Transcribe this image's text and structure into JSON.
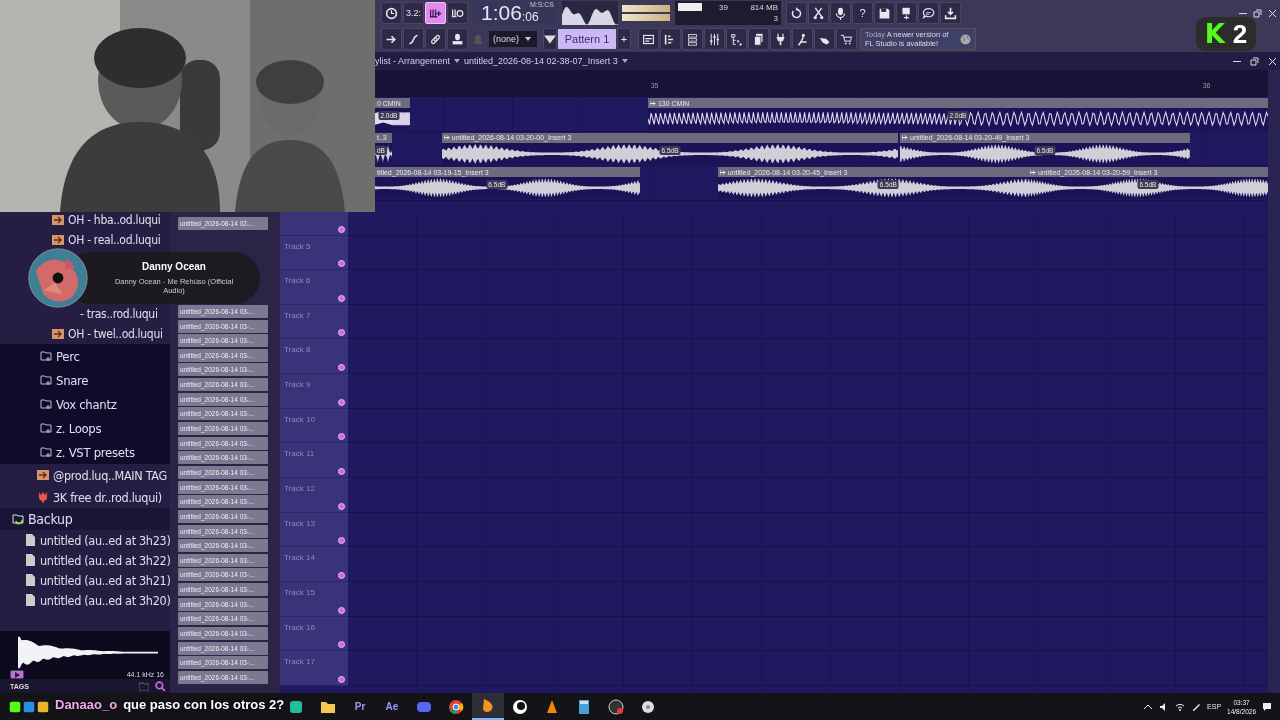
{
  "stream_badge": {
    "logo": "K",
    "count": "2"
  },
  "toolbar": {
    "modes": [
      {
        "kind": "wait",
        "selected": false
      },
      {
        "kind": "countdown",
        "label": "3.2:",
        "selected": false
      },
      {
        "kind": "step",
        "selected": true
      },
      {
        "kind": "loop",
        "selected": false
      }
    ],
    "time_main": "1:06",
    "time_small": ":06",
    "time_unit": "M:S:CS",
    "cpu": "39",
    "memory": "814 MB",
    "polyphony": "3",
    "actions": [
      {
        "kind": "undo"
      },
      {
        "kind": "cut"
      },
      {
        "kind": "mic"
      },
      {
        "kind": "help",
        "label": "?"
      },
      {
        "kind": "save"
      },
      {
        "kind": "save-new"
      },
      {
        "kind": "chat"
      },
      {
        "kind": "download"
      }
    ],
    "tools": [
      {
        "kind": "arrow"
      },
      {
        "kind": "curve"
      },
      {
        "kind": "link"
      },
      {
        "kind": "stamp"
      }
    ],
    "pattern_selector": {
      "value": "(none)"
    },
    "pattern": "Pattern 1",
    "add_pattern": "+",
    "windows": [
      {
        "kind": "playlist"
      },
      {
        "kind": "piano"
      },
      {
        "kind": "channels"
      },
      {
        "kind": "mixer"
      },
      {
        "kind": "browser"
      },
      {
        "kind": "copy"
      },
      {
        "kind": "plug"
      },
      {
        "kind": "figure"
      },
      {
        "kind": "hand"
      },
      {
        "kind": "cart"
      }
    ],
    "news": {
      "date": "Today",
      "text": "A newer version of FL Studio is available!"
    }
  },
  "playlist": {
    "title": "ylist - Arrangement",
    "pattern": "untitled_2026-08-14 02-38-07_Insert 3",
    "ruler": [
      "35",
      "36"
    ],
    "lanes": [
      {
        "clips": [
          {
            "kind": "automation",
            "title": "0 CMIN",
            "gain": "2.0dB",
            "cut_off": true
          },
          {
            "kind": "automation",
            "title": "130 CMIN",
            "gain": "2.0dB",
            "cut_off": false
          }
        ]
      },
      {
        "clips": [
          {
            "kind": "audio",
            "title": "t..3",
            "gain": "dB",
            "cut_off": true
          },
          {
            "kind": "audio",
            "title": "untitled_2026-08-14 03-20-00_Insert 3",
            "gain": "6.5dB",
            "cut_off": false
          },
          {
            "kind": "audio",
            "title": "untitled_2026-08-14 03-20-49_Insert 3",
            "gain": "6.5dB",
            "cut_off": false
          }
        ]
      },
      {
        "clips": [
          {
            "kind": "audio",
            "title": "titled_2026-08-14 03-19-15_Insert 3",
            "gain": "6.5dB",
            "cut_off": true
          },
          {
            "kind": "audio",
            "title": "untitled_2026-08-14 03-20-45_Insert 3",
            "gain": "6.5dB",
            "cut_off": false
          },
          {
            "kind": "audio",
            "title": "untitled_2026-08-14 03-20-59_Insert 3",
            "gain": "6.5dB",
            "cut_off": false
          }
        ]
      }
    ],
    "tracks": [
      {
        "name": "Track 5"
      },
      {
        "name": "Track 6"
      },
      {
        "name": "Track 7"
      },
      {
        "name": "Track 8"
      },
      {
        "name": "Track 9"
      },
      {
        "name": "Track 10"
      },
      {
        "name": "Track 11"
      },
      {
        "name": "Track 12"
      },
      {
        "name": "Track 13"
      },
      {
        "name": "Track 14"
      },
      {
        "name": "Track 15"
      },
      {
        "name": "Track 16"
      },
      {
        "name": "Track 17"
      }
    ]
  },
  "channel_clips": [
    "untitled_2026-08-14 02-...",
    "untitled_2026-08-14 03-...",
    "untitled_2026-08-14 03-...",
    "untitled_2026-08-14 03-...",
    "untitled_2026-08-14 03-...",
    "untitled_2026-08-14 03-...",
    "untitled_2026-08-14 03-...",
    "untitled_2026-08-14 03-...",
    "untitled_2026-08-14 03-...",
    "untitled_2026-08-14 03-...",
    "untitled_2026-08-14 03-...",
    "untitled_2026-08-14 03-...",
    "untitled_2026-08-14 03-...",
    "untitled_2026-08-14 03-...",
    "untitled_2026-08-14 03-...",
    "untitled_2026-08-14 03-...",
    "untitled_2026-08-14 03-...",
    "untitled_2026-08-14 03-...",
    "untitled_2026-08-14 03-...",
    "untitled_2026-08-14 03-...",
    "untitled_2026-08-14 03-...",
    "untitled_2026-08-14 03-...",
    "untitled_2026-08-14 03-...",
    "untitled_2026-08-14 03-...",
    "untitled_2026-08-14 03-...",
    "untitled_2026-08-14 03-...",
    "untitled_2026-08-14 03-..."
  ],
  "browser": {
    "items": [
      {
        "kind": "audio",
        "label": "OH - hba..od.luqui"
      },
      {
        "kind": "audio",
        "label": "OH - real..od.luqui"
      },
      {
        "kind": "hidden"
      },
      {
        "kind": "hidden"
      },
      {
        "kind": "partial",
        "label": "- tras..rod.luqui"
      },
      {
        "kind": "audio",
        "label": "OH - twel..od.luqui"
      },
      {
        "kind": "folder",
        "label": "Perc"
      },
      {
        "kind": "folder",
        "label": "Snare"
      },
      {
        "kind": "folder",
        "label": "Vox chantz"
      },
      {
        "kind": "folder",
        "label": "z. Loops"
      },
      {
        "kind": "folder",
        "label": "z. VST presets"
      },
      {
        "kind": "tag",
        "label": "@prod.luq..MAIN TAG"
      },
      {
        "kind": "plugin",
        "label": "3K free dr..rod.luqui)"
      },
      {
        "kind": "backup",
        "label": "Backup",
        "expanded": true,
        "children": [
          {
            "kind": "file",
            "label": "untitled (au..ed at 3h23)"
          },
          {
            "kind": "file",
            "label": "untitled (au..ed at 3h22)"
          },
          {
            "kind": "file",
            "label": "untitled (au..ed at 3h21)"
          },
          {
            "kind": "file",
            "label": "untitled (au..ed at 3h20)"
          }
        ]
      }
    ],
    "sample_info": "44.1 kHz 16",
    "tags": "TAGS"
  },
  "now_playing": {
    "artist": "Danny Ocean",
    "title": "Danny Ocean - Me Rehúso (Official Audio)"
  },
  "chat": {
    "user": "Danaao_o",
    "message": "que paso con los otros 2?"
  },
  "taskbar": {
    "apps": [
      {
        "kind": "kick"
      },
      {
        "kind": "blue"
      },
      {
        "kind": "yellow"
      },
      {
        "kind": "green"
      },
      {
        "kind": "files"
      },
      {
        "kind": "text",
        "label": "Pr",
        "color": "#9999ff"
      },
      {
        "kind": "text",
        "label": "Ae",
        "color": "#9999ff"
      },
      {
        "kind": "discord"
      },
      {
        "kind": "chrome"
      },
      {
        "kind": "fl",
        "selected": true
      },
      {
        "kind": "circle"
      },
      {
        "kind": "cone"
      },
      {
        "kind": "calc"
      },
      {
        "kind": "gauge"
      },
      {
        "kind": "gear"
      }
    ],
    "language": "ESP",
    "time": "03:37",
    "date": "14/8/2026"
  }
}
